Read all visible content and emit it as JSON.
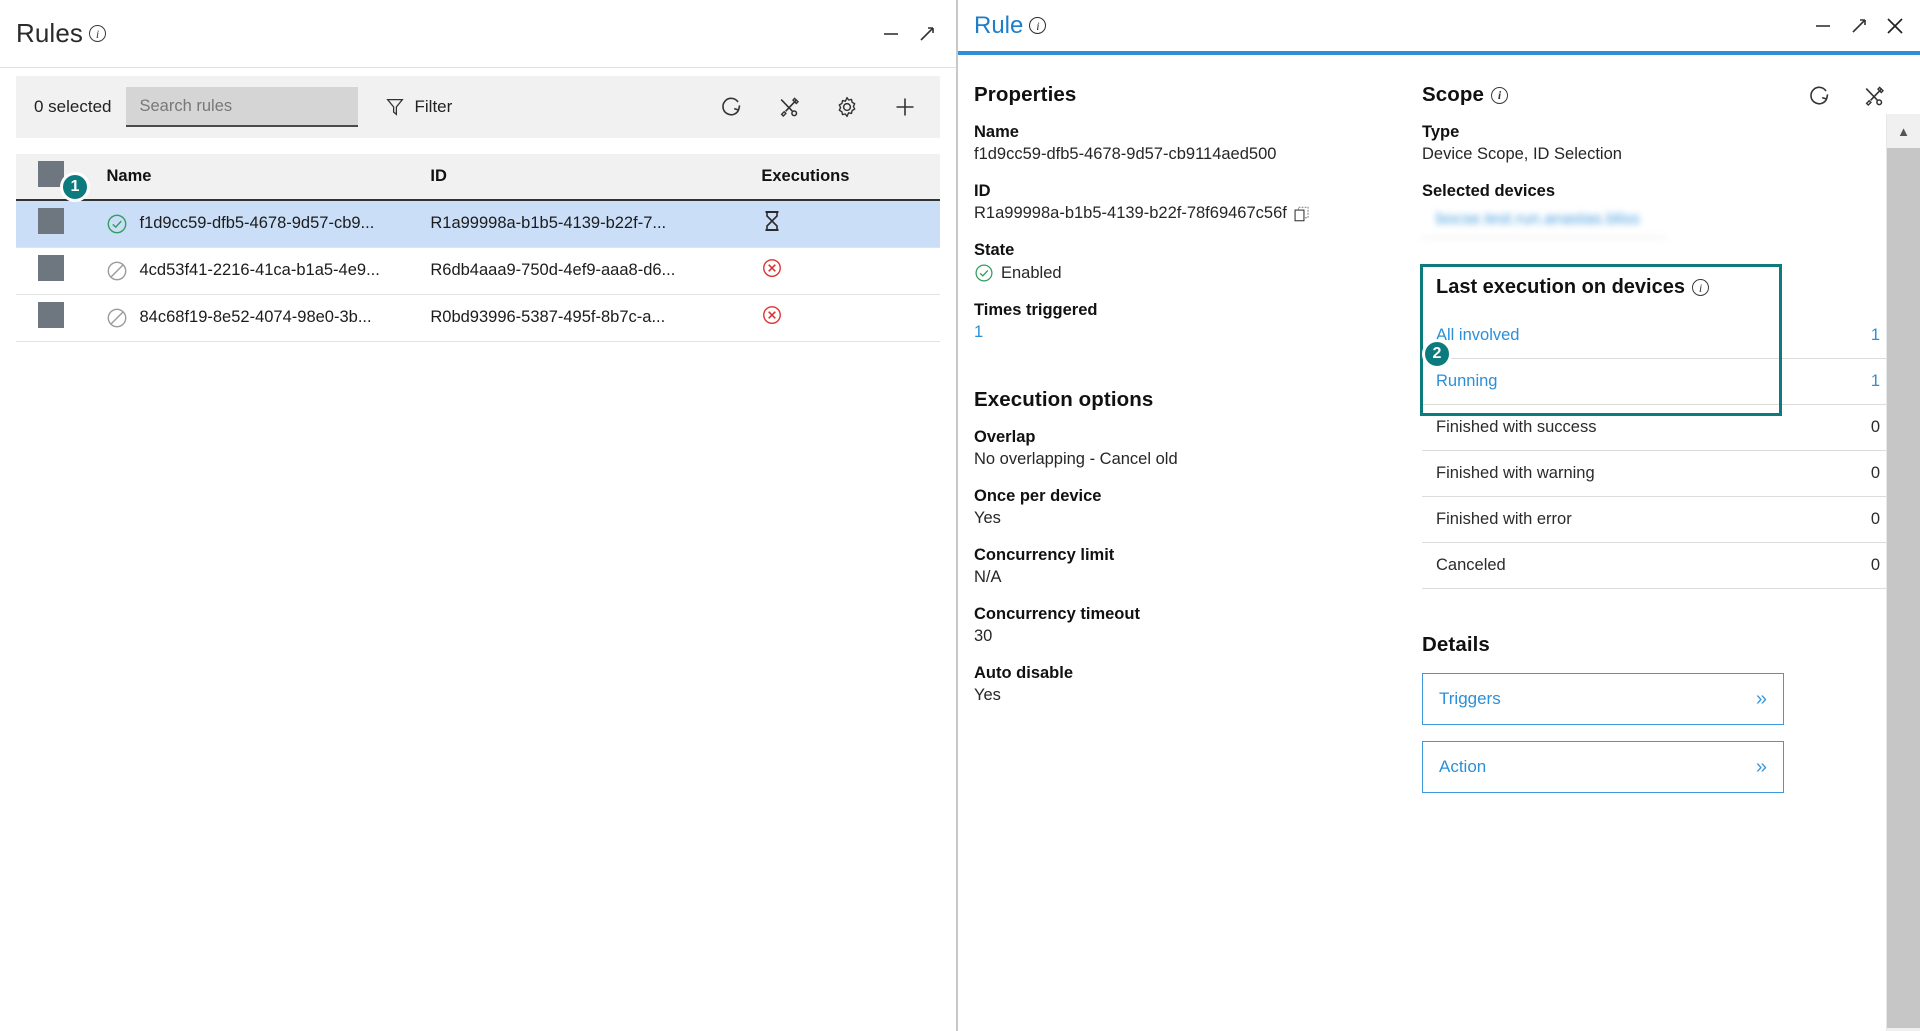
{
  "left": {
    "title": "Rules",
    "window_controls": [
      {
        "name": "minimize",
        "glyph": "—"
      },
      {
        "name": "expand",
        "glyph": "⤢"
      }
    ],
    "toolbar": {
      "selected_text": "0 selected",
      "search_placeholder": "Search rules",
      "search_value": "",
      "filter_label": "Filter",
      "icons": [
        "refresh-icon",
        "tools-icon",
        "gear-icon",
        "plus-icon"
      ]
    },
    "table": {
      "columns": [
        "",
        "Name",
        "ID",
        "Executions"
      ],
      "rows": [
        {
          "state": "enabled",
          "name": "f1d9cc59-dfb5-4678-9d57-cb9...",
          "id": "R1a99998a-b1b5-4139-b22f-7...",
          "execution": "running",
          "selected": true
        },
        {
          "state": "disabled",
          "name": "4cd53f41-2216-41ca-b1a5-4e9...",
          "id": "R6db4aaa9-750d-4ef9-aaa8-d6...",
          "execution": "error",
          "selected": false
        },
        {
          "state": "disabled",
          "name": "84c68f19-8e52-4074-98e0-3b...",
          "id": "R0bd93996-5387-495f-8b7c-a...",
          "execution": "error",
          "selected": false
        }
      ]
    }
  },
  "right": {
    "title": "Rule",
    "window_controls": [
      {
        "name": "minimize",
        "glyph": "—"
      },
      {
        "name": "expand",
        "glyph": "⤢"
      },
      {
        "name": "close",
        "glyph": "✕"
      }
    ],
    "properties": {
      "heading": "Properties",
      "name_label": "Name",
      "name_value": "f1d9cc59-dfb5-4678-9d57-cb9114aed500",
      "id_label": "ID",
      "id_value": "R1a99998a-b1b5-4139-b22f-78f69467c56f",
      "state_label": "State",
      "state_value": "Enabled",
      "times_triggered_label": "Times triggered",
      "times_triggered_value": "1"
    },
    "execution_options": {
      "heading": "Execution options",
      "overlap_label": "Overlap",
      "overlap_value": "No overlapping - Cancel old",
      "once_per_device_label": "Once per device",
      "once_per_device_value": "Yes",
      "concurrency_limit_label": "Concurrency limit",
      "concurrency_limit_value": "N/A",
      "concurrency_timeout_label": "Concurrency timeout",
      "concurrency_timeout_value": "30",
      "auto_disable_label": "Auto disable",
      "auto_disable_value": "Yes"
    },
    "scope": {
      "heading": "Scope",
      "type_label": "Type",
      "type_value": "Device Scope, ID Selection",
      "selected_devices_label": "Selected devices",
      "devices": [
        "bocse.test.run.anastas.bliss"
      ],
      "icons": [
        "refresh-icon",
        "tools-icon"
      ]
    },
    "last_execution": {
      "heading": "Last execution on devices",
      "rows": [
        {
          "label": "All involved",
          "value": "1",
          "link": true
        },
        {
          "label": "Running",
          "value": "1",
          "link": true
        },
        {
          "label": "Finished with success",
          "value": "0",
          "link": false
        },
        {
          "label": "Finished with warning",
          "value": "0",
          "link": false
        },
        {
          "label": "Finished with error",
          "value": "0",
          "link": false
        },
        {
          "label": "Canceled",
          "value": "0",
          "link": false
        }
      ]
    },
    "details": {
      "heading": "Details",
      "buttons": [
        {
          "label": "Triggers",
          "chevron": "»"
        },
        {
          "label": "Action",
          "chevron": "»"
        }
      ]
    }
  },
  "markers": [
    {
      "id": "1",
      "target": "selected-rule-row"
    },
    {
      "id": "2",
      "target": "last-execution-on-devices"
    }
  ],
  "colors": {
    "accent_teal": "#0d7b7e",
    "link_blue": "#2b8fd8",
    "header_blue": "#2d8fd5",
    "selection_blue": "#cbdef7",
    "status_green": "#2f9e5e",
    "status_red": "#e03030"
  }
}
